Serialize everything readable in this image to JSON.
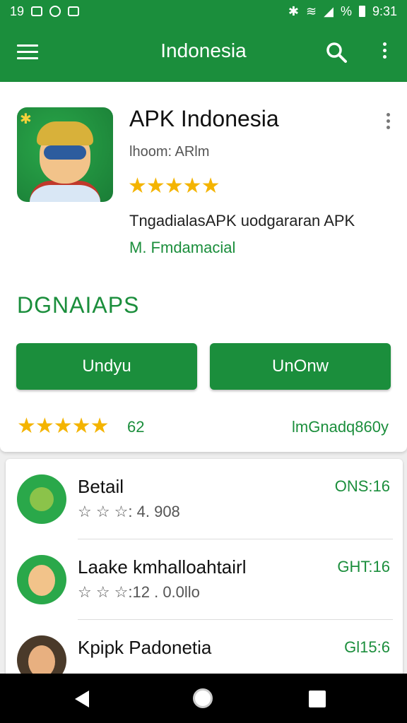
{
  "status_bar": {
    "time": "19",
    "right_text": "%",
    "clock": "9:31"
  },
  "app_bar": {
    "title": "Indonesia",
    "menu_icon": "hamburger-icon",
    "search_icon": "search-icon",
    "more_icon": "more-vert-icon"
  },
  "featured": {
    "name": "APK Indonesia",
    "subtitle": "lhoom: ARlm",
    "stars": "★★★★★",
    "description": "TngadialasAPK uodgararan APK",
    "link": "M. Fmdamacial",
    "section_title": "DGNAIAPS",
    "button_left": "Undyu",
    "button_right": "UnOnw",
    "bottom_stars": "★★★★★",
    "rating_count": "62",
    "rating_right": "lmGnadq860y"
  },
  "list": [
    {
      "title": "Betail",
      "meta": "☆ ☆ ☆: 4. 908",
      "right": "ONS:16"
    },
    {
      "title": "Laake kmhalloahtairl",
      "meta": "☆ ☆ ☆:12 . 0.0llo",
      "right": "GHT:16"
    },
    {
      "title": "Kpipk Padonetia",
      "meta": "",
      "right": "Gl15:6"
    }
  ],
  "colors": {
    "primary": "#1b8e3c",
    "star": "#f4b400"
  }
}
